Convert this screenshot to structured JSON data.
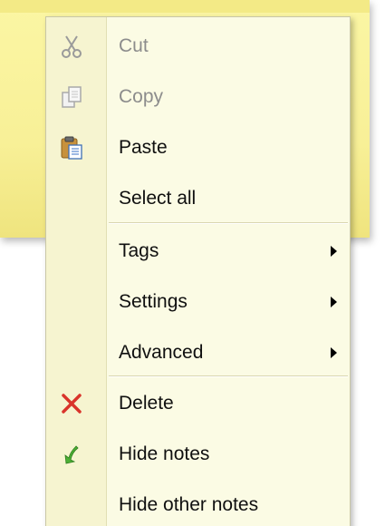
{
  "menu": {
    "items": [
      {
        "label": "Cut",
        "icon": "scissors-icon",
        "enabled": false
      },
      {
        "label": "Copy",
        "icon": "copy-icon",
        "enabled": false
      },
      {
        "label": "Paste",
        "icon": "paste-icon",
        "enabled": true
      },
      {
        "label": "Select all",
        "icon": "",
        "enabled": true
      },
      {
        "label": "Tags",
        "icon": "",
        "enabled": true,
        "submenu": true
      },
      {
        "label": "Settings",
        "icon": "",
        "enabled": true,
        "submenu": true
      },
      {
        "label": "Advanced",
        "icon": "",
        "enabled": true,
        "submenu": true
      },
      {
        "label": "Delete",
        "icon": "delete-x-icon",
        "enabled": true
      },
      {
        "label": "Hide notes",
        "icon": "green-arrow-icon",
        "enabled": true
      },
      {
        "label": "Hide other notes",
        "icon": "",
        "enabled": true
      }
    ]
  },
  "colors": {
    "note": "#f8f097",
    "menu_background": "#fbfbe4",
    "delete_red": "#d9342b",
    "hide_green": "#4caf35",
    "disabled_text": "#8c8c8c"
  }
}
